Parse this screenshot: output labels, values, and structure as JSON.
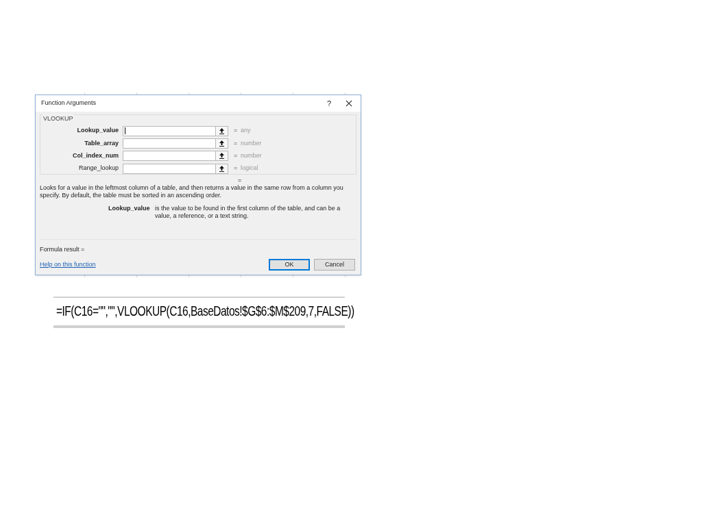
{
  "dialog": {
    "title": "Function Arguments",
    "help_button": "?",
    "function_name": "VLOOKUP",
    "arguments": [
      {
        "label": "Lookup_value",
        "required": true,
        "focused": true,
        "equals": "=",
        "result": "any"
      },
      {
        "label": "Table_array",
        "required": true,
        "focused": false,
        "equals": "=",
        "result": "number"
      },
      {
        "label": "Col_index_num",
        "required": true,
        "focused": false,
        "equals": "=",
        "result": "number"
      },
      {
        "label": "Range_lookup",
        "required": false,
        "focused": false,
        "equals": "=",
        "result": "logical"
      }
    ],
    "result_equals": "=",
    "description": "Looks for a value in the leftmost column of a table, and then returns a value in the same row from a column you specify. By default, the table must be sorted in an ascending order.",
    "arg_help": {
      "name": "Lookup_value",
      "text": "is the value to be found in the first column of the table, and can be a value, a reference, or a text string."
    },
    "formula_result": "Formula result =",
    "help_link": "Help on this function",
    "buttons": [
      {
        "label": "OK",
        "default": true
      },
      {
        "label": "Cancel",
        "default": false
      }
    ]
  },
  "formula": "=IF(C16=\"\",\"\",VLOOKUP(C16,BaseDatos!$G$6:$M$209,7,FALSE))"
}
